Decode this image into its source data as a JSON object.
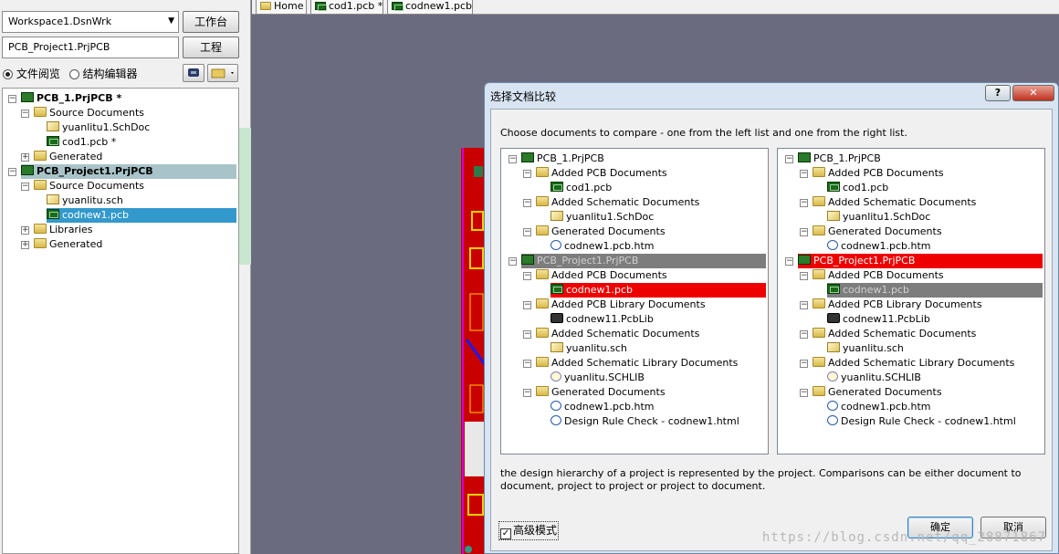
{
  "left_panel": {
    "workspace_value": "Workspace1.DsnWrk",
    "workbench_button": "工作台",
    "project_value": "PCB_Project1.PrjPCB",
    "project_button": "工程",
    "radio_file_view": "文件阅览",
    "radio_struct_editor": "结构编辑器",
    "tree": [
      {
        "label": "PCB_1.PrjPCB *",
        "level": 0,
        "icon": "project-icon",
        "toggle": "−",
        "bold": true
      },
      {
        "label": "Source Documents",
        "level": 1,
        "icon": "folder-icon",
        "toggle": "−"
      },
      {
        "label": "yuanlitu1.SchDoc",
        "level": 2,
        "icon": "schematic-icon"
      },
      {
        "label": "cod1.pcb *",
        "level": 2,
        "icon": "pcb-icon"
      },
      {
        "label": "Generated",
        "level": 1,
        "icon": "folder-icon",
        "toggle": "+"
      },
      {
        "label": "PCB_Project1.PrjPCB",
        "level": 0,
        "icon": "project-icon",
        "toggle": "−",
        "bold": true,
        "selected": "gray"
      },
      {
        "label": "Source Documents",
        "level": 1,
        "icon": "folder-icon",
        "toggle": "−"
      },
      {
        "label": "yuanlitu.sch",
        "level": 2,
        "icon": "schematic-icon"
      },
      {
        "label": "codnew1.pcb",
        "level": 2,
        "icon": "pcb-icon",
        "selected": "blue"
      },
      {
        "label": "Libraries",
        "level": 1,
        "icon": "folder-icon",
        "toggle": "+"
      },
      {
        "label": "Generated",
        "level": 1,
        "icon": "folder-icon",
        "toggle": "+"
      }
    ]
  },
  "tabs": [
    {
      "label": "Home",
      "icon": "home-icon"
    },
    {
      "label": "cod1.pcb *",
      "icon": "pcb-icon"
    },
    {
      "label": "codnew1.pcb",
      "icon": "pcb-icon"
    }
  ],
  "dialog": {
    "title": "选择文档比较",
    "help_button": "?",
    "close_button": "✕",
    "instruction": "Choose documents to compare - one from the left list and one from the right list.",
    "left_list": [
      {
        "label": "PCB_1.PrjPCB",
        "level": 0,
        "icon": "project-icon",
        "toggle": "−"
      },
      {
        "label": "Added PCB Documents",
        "level": 1,
        "icon": "folder-icon",
        "toggle": "−"
      },
      {
        "label": "cod1.pcb",
        "level": 2,
        "icon": "pcb-icon"
      },
      {
        "label": "Added Schematic Documents",
        "level": 1,
        "icon": "folder-icon",
        "toggle": "−"
      },
      {
        "label": "yuanlitu1.SchDoc",
        "level": 2,
        "icon": "schematic-icon"
      },
      {
        "label": "Generated Documents",
        "level": 1,
        "icon": "folder-icon",
        "toggle": "−"
      },
      {
        "label": "codnew1.pcb.htm",
        "level": 2,
        "icon": "html-doc-icon"
      },
      {
        "label": "PCB_Project1.PrjPCB",
        "level": 0,
        "icon": "project-icon",
        "toggle": "−",
        "highlight": "gray"
      },
      {
        "label": "Added PCB Documents",
        "level": 1,
        "icon": "folder-icon",
        "toggle": "−"
      },
      {
        "label": "codnew1.pcb",
        "level": 2,
        "icon": "pcb-icon",
        "highlight": "red"
      },
      {
        "label": "Added PCB Library Documents",
        "level": 1,
        "icon": "folder-icon",
        "toggle": "−"
      },
      {
        "label": "codnew11.PcbLib",
        "level": 2,
        "icon": "pcb-library-icon"
      },
      {
        "label": "Added Schematic Documents",
        "level": 1,
        "icon": "folder-icon",
        "toggle": "−"
      },
      {
        "label": "yuanlitu.sch",
        "level": 2,
        "icon": "schematic-icon"
      },
      {
        "label": "Added Schematic Library Documents",
        "level": 1,
        "icon": "folder-icon",
        "toggle": "−"
      },
      {
        "label": "yuanlitu.SCHLIB",
        "level": 2,
        "icon": "schematic-library-icon"
      },
      {
        "label": "Generated Documents",
        "level": 1,
        "icon": "folder-icon",
        "toggle": "−"
      },
      {
        "label": "codnew1.pcb.htm",
        "level": 2,
        "icon": "html-doc-icon"
      },
      {
        "label": "Design Rule Check - codnew1.html",
        "level": 2,
        "icon": "html-doc-icon"
      }
    ],
    "right_list": [
      {
        "label": "PCB_1.PrjPCB",
        "level": 0,
        "icon": "project-icon",
        "toggle": "−"
      },
      {
        "label": "Added PCB Documents",
        "level": 1,
        "icon": "folder-icon",
        "toggle": "−"
      },
      {
        "label": "cod1.pcb",
        "level": 2,
        "icon": "pcb-icon"
      },
      {
        "label": "Added Schematic Documents",
        "level": 1,
        "icon": "folder-icon",
        "toggle": "−"
      },
      {
        "label": "yuanlitu1.SchDoc",
        "level": 2,
        "icon": "schematic-icon"
      },
      {
        "label": "Generated Documents",
        "level": 1,
        "icon": "folder-icon",
        "toggle": "−"
      },
      {
        "label": "codnew1.pcb.htm",
        "level": 2,
        "icon": "html-doc-icon"
      },
      {
        "label": "PCB_Project1.PrjPCB",
        "level": 0,
        "icon": "project-icon",
        "toggle": "−",
        "highlight": "red"
      },
      {
        "label": "Added PCB Documents",
        "level": 1,
        "icon": "folder-icon",
        "toggle": "−"
      },
      {
        "label": "codnew1.pcb",
        "level": 2,
        "icon": "pcb-icon",
        "highlight": "gray"
      },
      {
        "label": "Added PCB Library Documents",
        "level": 1,
        "icon": "folder-icon",
        "toggle": "−"
      },
      {
        "label": "codnew11.PcbLib",
        "level": 2,
        "icon": "pcb-library-icon"
      },
      {
        "label": "Added Schematic Documents",
        "level": 1,
        "icon": "folder-icon",
        "toggle": "−"
      },
      {
        "label": "yuanlitu.sch",
        "level": 2,
        "icon": "schematic-icon"
      },
      {
        "label": "Added Schematic Library Documents",
        "level": 1,
        "icon": "folder-icon",
        "toggle": "−"
      },
      {
        "label": "yuanlitu.SCHLIB",
        "level": 2,
        "icon": "schematic-library-icon"
      },
      {
        "label": "Generated Documents",
        "level": 1,
        "icon": "folder-icon",
        "toggle": "−"
      },
      {
        "label": "codnew1.pcb.htm",
        "level": 2,
        "icon": "html-doc-icon"
      },
      {
        "label": "Design Rule Check - codnew1.html",
        "level": 2,
        "icon": "html-doc-icon"
      }
    ],
    "description": "the design hierarchy of a project is represented by the project. Comparisons can be either document to document, project to project or project to document.",
    "advanced_mode_label": "高级模式",
    "advanced_mode_checked": true,
    "ok_button": "确定",
    "cancel_button": "取消"
  },
  "watermark": "https://blog.csdn.net/qq_28871867"
}
